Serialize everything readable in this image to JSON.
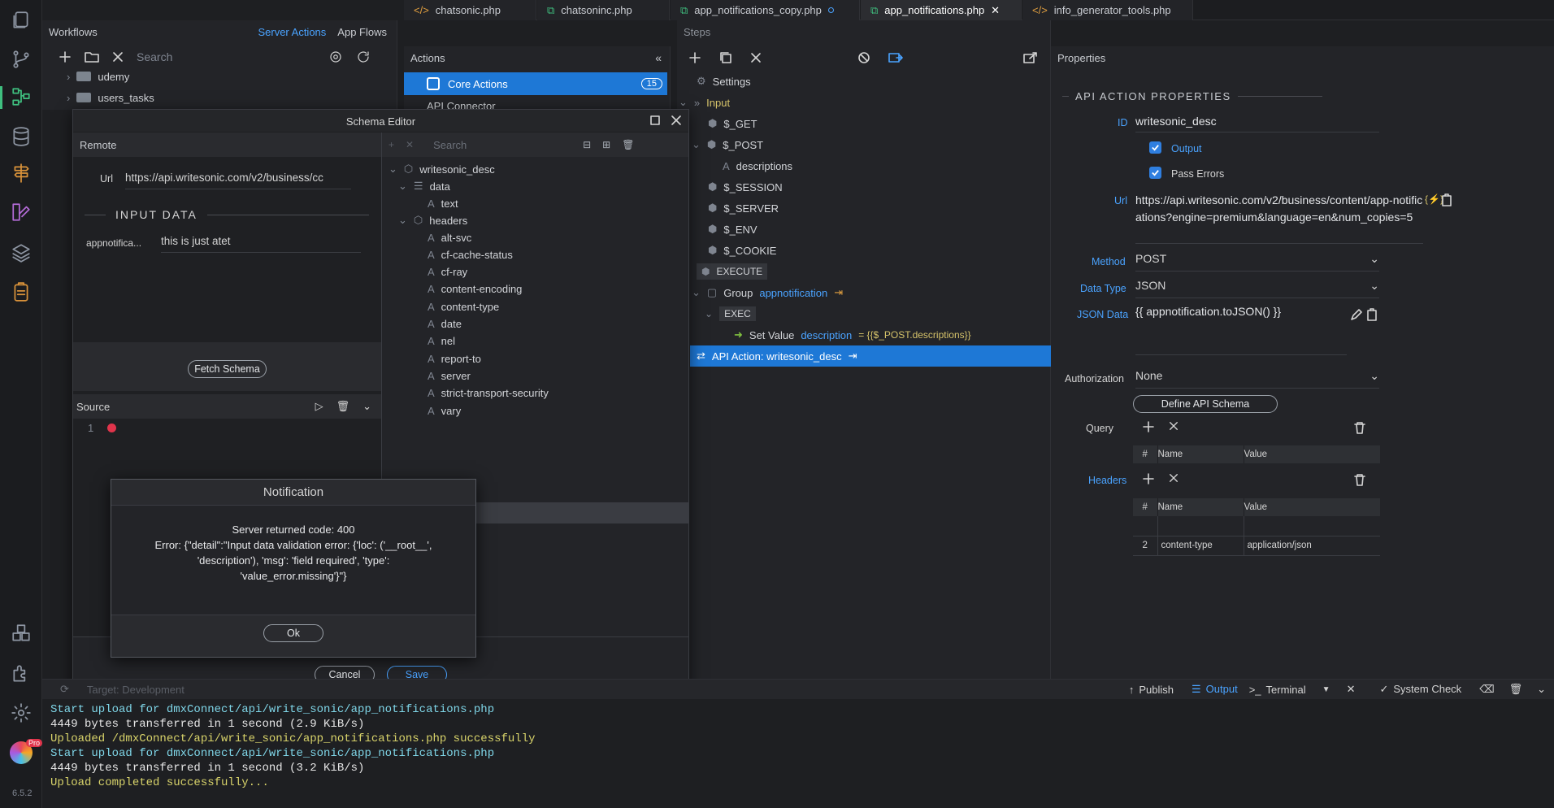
{
  "tabs": [
    {
      "label": "chatsonic.php",
      "type": "code"
    },
    {
      "label": "chatsoninc.php",
      "type": "flow"
    },
    {
      "label": "app_notifications_copy.php",
      "type": "flow",
      "modified": true
    },
    {
      "label": "app_notifications.php",
      "type": "flow",
      "active": true
    },
    {
      "label": "info_generator_tools.php",
      "type": "code"
    }
  ],
  "workflows": {
    "title": "Workflows",
    "links": [
      "Server Actions",
      "App Flows"
    ],
    "search_placeholder": "Search",
    "tree": [
      "udemy",
      "users_tasks"
    ]
  },
  "actions": {
    "title": "Actions",
    "core_label": "Core Actions",
    "core_count": "15",
    "api_connector": "API Connector"
  },
  "steps": {
    "title": "Steps",
    "items": {
      "settings": "Settings",
      "input": "Input",
      "get": "$_GET",
      "post": "$_POST",
      "descriptions": "descriptions",
      "session": "$_SESSION",
      "server": "$_SERVER",
      "env": "$_ENV",
      "cookie": "$_COOKIE",
      "execute": "EXECUTE",
      "group": "Group",
      "group_name": "appnotification",
      "exec": "EXEC",
      "set_value": "Set Value",
      "set_value_name": "description",
      "set_value_expr": "= {{$_POST.descriptions}}",
      "api_action": "API Action: writesonic_desc"
    }
  },
  "properties": {
    "title": "Properties",
    "section": "API ACTION PROPERTIES",
    "id_label": "ID",
    "id_value": "writesonic_desc",
    "output_label": "Output",
    "pass_errors_label": "Pass Errors",
    "url_label": "Url",
    "url_value": "https://api.writesonic.com/v2/business/content/app-notifications?engine=premium&language=en&num_copies=5",
    "method_label": "Method",
    "method_value": "POST",
    "data_type_label": "Data Type",
    "data_type_value": "JSON",
    "json_data_label": "JSON Data",
    "json_data_value": "{{ appnotification.toJSON() }}",
    "authorization_label": "Authorization",
    "authorization_value": "None",
    "define_schema": "Define API Schema",
    "query_label": "Query",
    "headers_label": "Headers",
    "col_hash": "#",
    "col_name": "Name",
    "col_value": "Value",
    "header_row": {
      "num": "2",
      "name": "content-type",
      "value": "application/json"
    }
  },
  "schema_editor": {
    "title": "Schema Editor",
    "remote_label": "Remote",
    "url_label": "Url",
    "url_value": "https://api.writesonic.com/v2/business/cc",
    "input_data_heading": "INPUT DATA",
    "input_name": "appnotifica...",
    "input_value": "this is just atet",
    "fetch_schema": "Fetch Schema",
    "source_label": "Source",
    "line_number": "1",
    "search_placeholder": "Search",
    "tree": {
      "root": "writesonic_desc",
      "data": "data",
      "text": "text",
      "headers": "headers",
      "header_items": [
        "alt-svc",
        "cf-cache-status",
        "cf-ray",
        "content-encoding",
        "content-type",
        "date",
        "nel",
        "report-to",
        "server",
        "strict-transport-security",
        "vary"
      ]
    },
    "cancel": "Cancel",
    "save": "Save"
  },
  "notification": {
    "title": "Notification",
    "line1": "Server returned code: 400",
    "line2": "Error: {\"detail\":\"Input data validation error: {'loc': ('__root__',",
    "line3": "'description'), 'msg': 'field required', 'type':",
    "line4": "'value_error.missing'}\"}",
    "ok": "Ok"
  },
  "bottom_bar": {
    "publish": "Publish",
    "output": "Output",
    "terminal": "Terminal",
    "system_check": "System Check",
    "partial": "Target: Development"
  },
  "console": [
    {
      "text": "Start upload for dmxConnect/api/write_sonic/app_notifications.php",
      "color": "#7fd6e8"
    },
    {
      "text": "4449 bytes transferred in 1 second (2.9 KiB/s)",
      "color": "#e6e6e6"
    },
    {
      "text": "Uploaded /dmxConnect/api/write_sonic/app_notifications.php successfully",
      "color": "#d8d36a"
    },
    {
      "text": "Start upload for dmxConnect/api/write_sonic/app_notifications.php",
      "color": "#7fd6e8"
    },
    {
      "text": "4449 bytes transferred in 1 second (3.2 KiB/s)",
      "color": "#e6e6e6"
    },
    {
      "text": "Upload completed successfully...",
      "color": "#d8d36a"
    }
  ],
  "version": "6.5.2",
  "pro_badge": "Pro"
}
